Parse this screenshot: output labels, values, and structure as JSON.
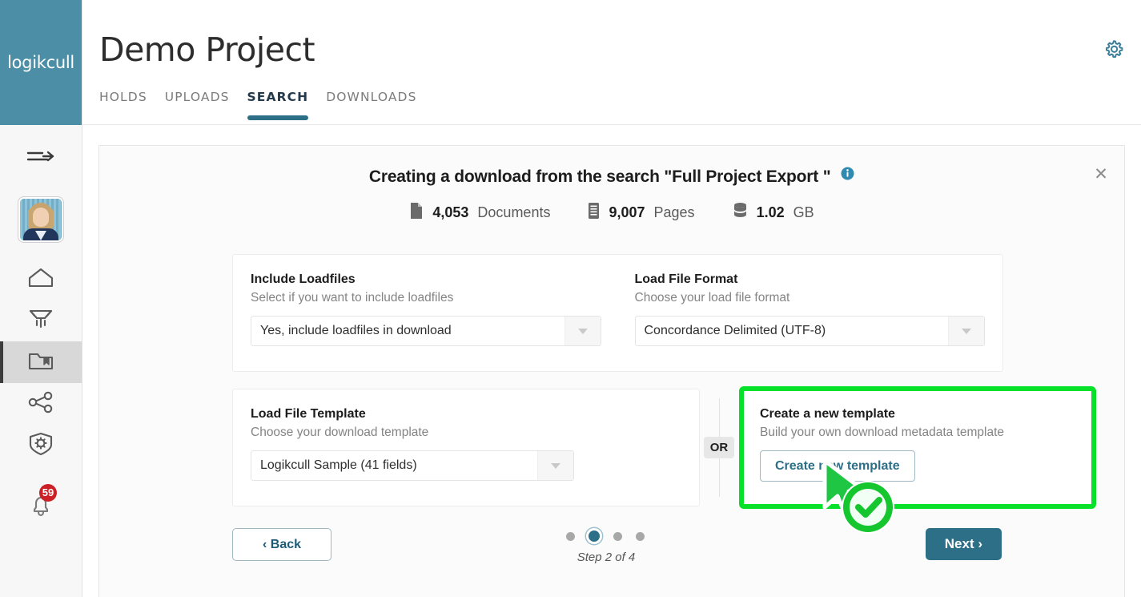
{
  "brand": {
    "logo_text": "logikcull",
    "teal": "#2d6f87",
    "sidebar_teal": "#4b8ea5",
    "highlight_green": "#08e129",
    "badge_red": "#cc2027"
  },
  "sidebar": {
    "items": [
      {
        "icon": "collapse-arrow-icon",
        "name": "sidebar-collapse"
      },
      {
        "icon": "user-avatar",
        "name": "sidebar-avatar"
      },
      {
        "icon": "home-icon",
        "name": "sidebar-item-home"
      },
      {
        "icon": "upload-funnel-icon",
        "name": "sidebar-item-uploads"
      },
      {
        "icon": "folder-bookmark-icon",
        "name": "sidebar-item-projects",
        "active": true
      },
      {
        "icon": "share-icon",
        "name": "sidebar-item-share"
      },
      {
        "icon": "shield-gear-icon",
        "name": "sidebar-item-admin"
      },
      {
        "icon": "bell-icon",
        "name": "sidebar-item-notifications",
        "badge": "59"
      }
    ],
    "notification_count": "59"
  },
  "header": {
    "title": "Demo Project",
    "tabs": [
      {
        "label": "HOLDS",
        "active": false
      },
      {
        "label": "UPLOADS",
        "active": false
      },
      {
        "label": "SEARCH",
        "active": true
      },
      {
        "label": "DOWNLOADS",
        "active": false
      }
    ],
    "settings_icon": "gear-icon"
  },
  "panel": {
    "close_icon": "close-icon",
    "heading": "Creating a download from the search \"Full Project Export \"",
    "info_icon": "info-icon",
    "stats": [
      {
        "icon": "document-icon",
        "value": "4,053",
        "label": "Documents"
      },
      {
        "icon": "pages-icon",
        "value": "9,007",
        "label": "Pages"
      },
      {
        "icon": "database-icon",
        "value": "1.02",
        "label": "GB"
      }
    ],
    "fields": {
      "include_loadfiles": {
        "title": "Include Loadfiles",
        "subtitle": "Select if you want to include loadfiles",
        "value": "Yes, include loadfiles in download"
      },
      "load_file_format": {
        "title": "Load File Format",
        "subtitle": "Choose your load file format",
        "value": "Concordance Delimited (UTF-8)"
      },
      "load_file_template": {
        "title": "Load File Template",
        "subtitle": "Choose your download template",
        "value": "Logikcull Sample (41 fields)"
      },
      "create_template": {
        "title": "Create a new template",
        "subtitle": "Build your own download metadata template",
        "button_label": "Create new template"
      }
    },
    "or_label": "OR",
    "footer": {
      "back_label": "‹ Back",
      "next_label": "Next ›",
      "step_label": "Step 2 of 4",
      "total_steps": 4,
      "current_step": 2
    }
  }
}
